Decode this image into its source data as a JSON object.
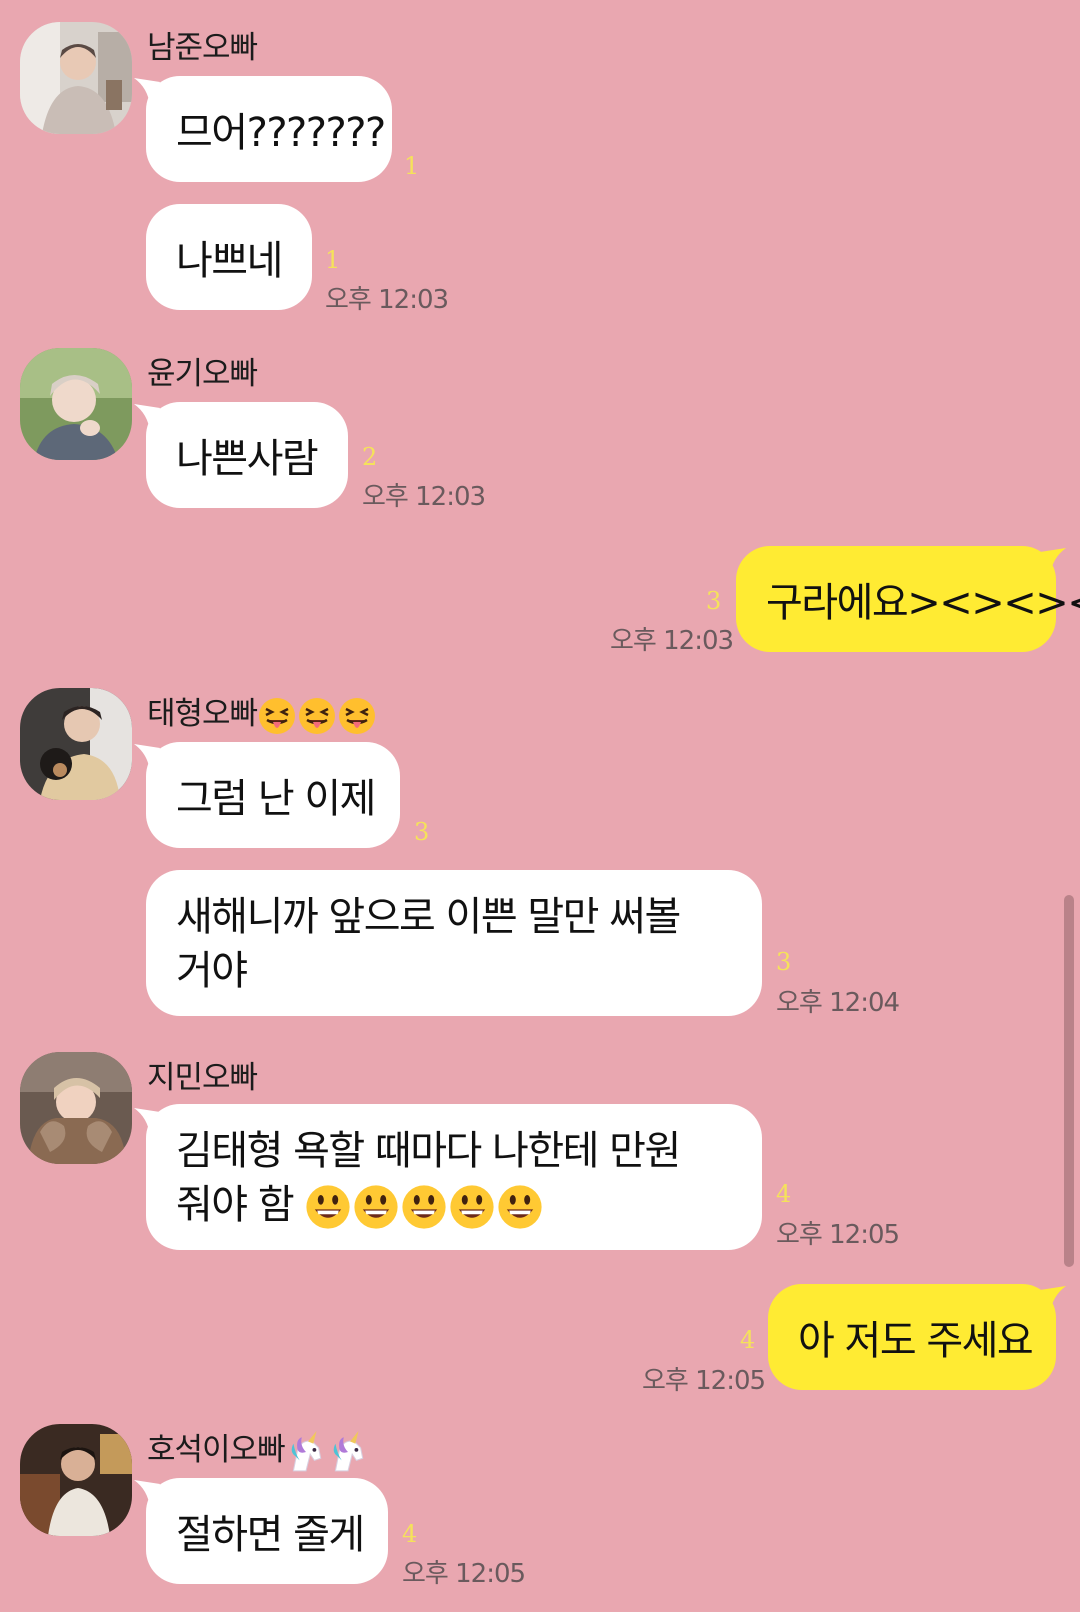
{
  "colors": {
    "background": "#e9a7b0",
    "incoming_bubble": "#ffffff",
    "outgoing_bubble": "#ffeb33",
    "unread_count": "#f5e25a",
    "timestamp": "#6a5a5d"
  },
  "messages": {
    "m1": {
      "sender": "남준오빠",
      "text": "므어???????",
      "unread": "1"
    },
    "m2": {
      "text": "나쁘네",
      "unread": "1",
      "time": "오후 12:03"
    },
    "m3": {
      "sender": "윤기오빠",
      "text": "나쁜사람",
      "unread": "2",
      "time": "오후 12:03"
    },
    "m4": {
      "text": "구라에요><><><",
      "unread": "3",
      "time": "오후 12:03"
    },
    "m5": {
      "sender": "태형오빠",
      "sender_emoji": [
        "squinting-tongue-emoji",
        "squinting-tongue-emoji",
        "squinting-tongue-emoji"
      ],
      "text": "그럼 난 이제",
      "unread": "3"
    },
    "m6": {
      "text_line1": "새해니까 앞으로 이쁜 말만 써볼",
      "text_line2": "거야",
      "unread": "3",
      "time": "오후 12:04"
    },
    "m7": {
      "sender": "지민오빠",
      "text_line1": "김태형 욕할 때마다 나한테 만원",
      "text_line2": "줘야 함",
      "text_emoji": [
        "grinning-face-emoji",
        "grinning-face-emoji",
        "grinning-face-emoji",
        "grinning-face-emoji",
        "grinning-face-emoji"
      ],
      "unread": "4",
      "time": "오후 12:05"
    },
    "m8": {
      "text": "아 저도 주세요",
      "unread": "4",
      "time": "오후 12:05"
    },
    "m9": {
      "sender": "호석이오빠",
      "sender_emoji": [
        "unicorn-emoji",
        "unicorn-emoji"
      ],
      "text": "절하면 줄게",
      "unread": "4",
      "time": "오후 12:05"
    }
  }
}
